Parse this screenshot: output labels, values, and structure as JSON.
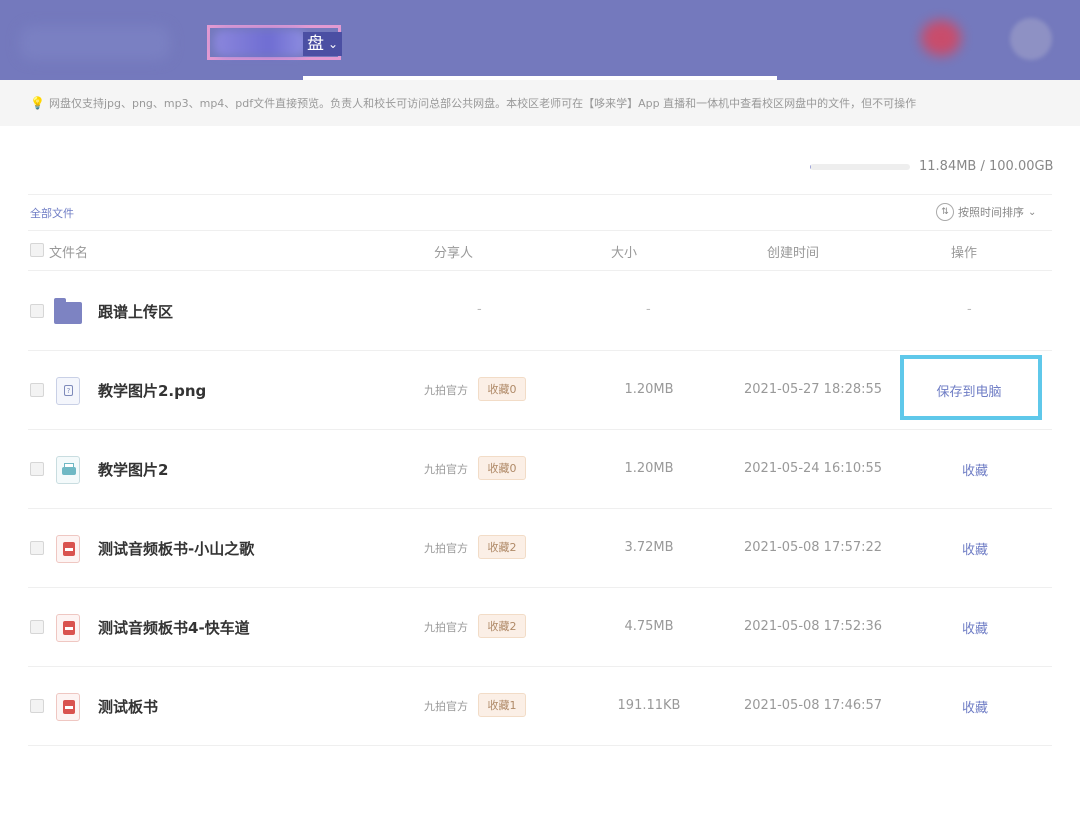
{
  "header": {
    "drive_label": "盘",
    "chevron": "chevron-down-icon"
  },
  "notice": {
    "icon": "lightbulb-icon",
    "text": "网盘仅支持jpg、png、mp3、mp4、pdf文件直接预览。负责人和校长可访问总部公共网盘。本校区老师可在【哆来学】App 直播和一体机中查看校区网盘中的文件，但不可操作"
  },
  "storage": {
    "used": "11.84MB",
    "total": "100.00GB",
    "text": "11.84MB / 100.00GB",
    "used_fraction": 0.0001
  },
  "breadcrumb": "全部文件",
  "sort_label": "按照时间排序",
  "columns": {
    "name": "文件名",
    "sharer": "分享人",
    "size": "大小",
    "created": "创建时间",
    "action": "操作"
  },
  "rows": [
    {
      "name": "跟谱上传区",
      "type": "folder",
      "sharer": "-",
      "badge": "",
      "size": "-",
      "created": "",
      "action": "-"
    },
    {
      "name": "教学图片2.png",
      "type": "image",
      "sharer": "九拍官方",
      "badge": "收藏0",
      "size": "1.20MB",
      "created": "2021-05-27 18:28:55",
      "action": "保存到电脑"
    },
    {
      "name": "教学图片2",
      "type": "printer",
      "sharer": "九拍官方",
      "badge": "收藏0",
      "size": "1.20MB",
      "created": "2021-05-24 16:10:55",
      "action": "收藏"
    },
    {
      "name": "测试音频板书-小山之歌",
      "type": "audio",
      "sharer": "九拍官方",
      "badge": "收藏2",
      "size": "3.72MB",
      "created": "2021-05-08 17:57:22",
      "action": "收藏"
    },
    {
      "name": "测试音频板书4-快车道",
      "type": "audio",
      "sharer": "九拍官方",
      "badge": "收藏2",
      "size": "4.75MB",
      "created": "2021-05-08 17:52:36",
      "action": "收藏"
    },
    {
      "name": "测试板书",
      "type": "audio",
      "sharer": "九拍官方",
      "badge": "收藏1",
      "size": "191.11KB",
      "created": "2021-05-08 17:46:57",
      "action": "收藏"
    }
  ]
}
